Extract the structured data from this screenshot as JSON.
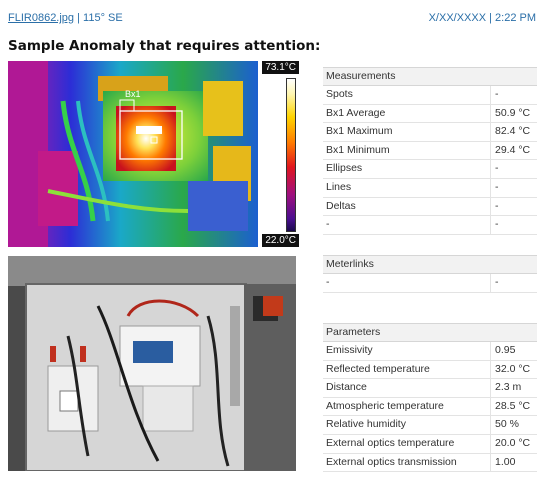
{
  "header": {
    "file": "FLIR0862.jpg",
    "separator": "|",
    "direction": "115° SE",
    "datetime": "X/XX/XXXX | 2:22 PM"
  },
  "title": "Sample Anomaly that requires attention:",
  "thermal": {
    "scale_max": "73.1°C",
    "scale_min": "22.0°C",
    "box_label": "Bx1"
  },
  "measurements": {
    "heading": "Measurements",
    "rows": [
      {
        "k": "Spots",
        "v": "-"
      },
      {
        "k": "Bx1 Average",
        "v": "50.9 °C"
      },
      {
        "k": "Bx1 Maximum",
        "v": "82.4 °C"
      },
      {
        "k": "Bx1 Minimum",
        "v": "29.4 °C"
      },
      {
        "k": "Ellipses",
        "v": "-"
      },
      {
        "k": "Lines",
        "v": "-"
      },
      {
        "k": "Deltas",
        "v": "-"
      },
      {
        "k": "-",
        "v": "-"
      }
    ]
  },
  "meterlinks": {
    "heading": "Meterlinks",
    "rows": [
      {
        "k": "-",
        "v": "-"
      }
    ]
  },
  "parameters": {
    "heading": "Parameters",
    "rows": [
      {
        "k": "Emissivity",
        "v": "0.95"
      },
      {
        "k": "Reflected temperature",
        "v": "32.0 °C"
      },
      {
        "k": "Distance",
        "v": "2.3 m"
      },
      {
        "k": "Atmospheric temperature",
        "v": "28.5 °C"
      },
      {
        "k": "Relative humidity",
        "v": "50 %"
      },
      {
        "k": "External optics temperature",
        "v": "20.0 °C"
      },
      {
        "k": "External optics transmission",
        "v": "1.00"
      }
    ]
  }
}
